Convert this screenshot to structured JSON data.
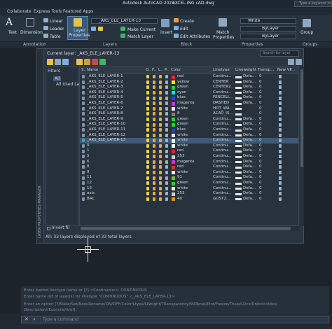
{
  "window": {
    "app_title": "Autodesk AutoCAD 2023",
    "doc_title": "eXCEL-iNG cAD.dwg",
    "search_placeholder": "Type a keyword or phrase"
  },
  "ribbon_tabs": [
    "Collaborate",
    "Express Tools",
    "Featured Apps"
  ],
  "ribbon": {
    "text_label": "Text",
    "dimension_label": "Dimension",
    "linear_label": "Linear",
    "leader_label": "Leader",
    "table_label": "Table",
    "layer_properties_label_1": "Layer",
    "layer_properties_label_2": "Properties",
    "current_layer_combo": "_AKS_ELE_LAYER-13",
    "make_current_label": "Make Current",
    "match_layer_label": "Match Layer",
    "insert_label": "Insert",
    "create_label": "Create",
    "edit_label": "Edit",
    "edit_attributes_label": "Edit Attributes",
    "match_properties_label_1": "Match",
    "match_properties_label_2": "Properties",
    "color_combo": "White",
    "linetype_combo": "ByLayer",
    "lineweight_combo": "ByLayer",
    "group_label": "Group",
    "colors": {
      "accent": "#1e8fe0",
      "ribbon_bg": "#27333f"
    }
  },
  "panel_titles": [
    "Annotation",
    "Layers",
    "Block",
    "Properties",
    "Groups"
  ],
  "layer_manager": {
    "side_title": "LAYER PROPERTIES MANAGER",
    "current_layer_text": "Current layer: _AKS_ELE_LAYER-13",
    "search_placeholder": "Search for layer",
    "filters_header": "Filters",
    "filter_items": [
      "All",
      "All Used Layers"
    ],
    "invert_filter": "Invert fil",
    "status_text": "All: 33 layers displayed of 33 total layers",
    "columns": [
      "S..",
      "Name",
      "O..",
      "F..",
      "L..",
      "P..",
      "Color",
      "Linetype",
      "Lineweight",
      "Transp...",
      "New VP..."
    ],
    "rows": [
      {
        "name": "_AKS_ELE_LAYER-1",
        "color_name": "red",
        "color_hex": "#e12b2b",
        "linetype": "Continu...",
        "lw": "Defa...",
        "tr": "0"
      },
      {
        "name": "_AKS_ELE_LAYER-2",
        "color_name": "yellow",
        "color_hex": "#ffff00",
        "linetype": "CENTER",
        "lw": "Defa...",
        "tr": "0"
      },
      {
        "name": "_AKS_ELE_LAYER-3",
        "color_name": "green",
        "color_hex": "#2bd42b",
        "linetype": "CENTER2",
        "lw": "Defa...",
        "tr": "0"
      },
      {
        "name": "_AKS_ELE_LAYER-4",
        "color_name": "cyan",
        "color_hex": "#00e5e5",
        "linetype": "Continu...",
        "lw": "Defa...",
        "tr": "0"
      },
      {
        "name": "_AKS_ELE_LAYER-5",
        "color_name": "blue",
        "color_hex": "#2b3bff",
        "linetype": "FENCELI...",
        "lw": "Defa...",
        "tr": "0"
      },
      {
        "name": "_AKS_ELE_LAYER-6",
        "color_name": "magenta",
        "color_hex": "#e02be0",
        "linetype": "DASHED",
        "lw": "Defa...",
        "tr": "0"
      },
      {
        "name": "_AKS_ELE_LAYER-7",
        "color_name": "white",
        "color_hex": "#ffffff",
        "linetype": "HOT_WA...",
        "lw": "",
        "tr": "0"
      },
      {
        "name": "_AKS_ELE_LAYER-8",
        "color_name": "8",
        "color_hex": "#808080",
        "linetype": "ACAD_IS...",
        "lw": "",
        "tr": "0"
      },
      {
        "name": "_AKS_ELE_LAYER-9",
        "color_name": "green",
        "color_hex": "#2bd42b",
        "linetype": "Continu...",
        "lw": "Defa...",
        "tr": "0"
      },
      {
        "name": "_AKS_ELE_LAYER-10",
        "color_name": "green",
        "color_hex": "#2bd42b",
        "linetype": "Continu...",
        "lw": "Defa...",
        "tr": "0"
      },
      {
        "name": "_AKS_ELE_LAYER-11",
        "color_name": "blue",
        "color_hex": "#2b3bff",
        "linetype": "Continu...",
        "lw": "Defa...",
        "tr": "0"
      },
      {
        "name": "_AKS_ELE_LAYER-12",
        "color_name": "white",
        "color_hex": "#ffffff",
        "linetype": "Continu...",
        "lw": "Defa...",
        "tr": "0"
      },
      {
        "name": "_AKS_ELE_LAYER-13",
        "color_name": "white",
        "color_hex": "#ffffff",
        "linetype": "Continu...",
        "lw": "Defa...",
        "tr": "0",
        "selected": true
      },
      {
        "name": "0",
        "color_name": "white",
        "color_hex": "#ffffff",
        "linetype": "Continu...",
        "lw": "Defa...",
        "tr": "0"
      },
      {
        "name": "1",
        "color_name": "red",
        "color_hex": "#e12b2b",
        "linetype": "Continu...",
        "lw": "Defa...",
        "tr": "0"
      },
      {
        "name": "5",
        "color_name": "253",
        "color_hex": "#d0d0d0",
        "linetype": "Continu...",
        "lw": "Defa...",
        "tr": "0"
      },
      {
        "name": "6",
        "color_name": "magenta",
        "color_hex": "#e02be0",
        "linetype": "Continu...",
        "lw": "Defa...",
        "tr": "0"
      },
      {
        "name": "8",
        "color_name": "red",
        "color_hex": "#e12b2b",
        "linetype": "Continu...",
        "lw": "Defa...",
        "tr": "0"
      },
      {
        "name": "9",
        "color_name": "white",
        "color_hex": "#ffffff",
        "linetype": "Continu...",
        "lw": "Defa...",
        "tr": "0"
      },
      {
        "name": "11",
        "color_name": "91",
        "color_hex": "#6fbf3f",
        "linetype": "Continu...",
        "lw": "Defa...",
        "tr": "0"
      },
      {
        "name": "12",
        "color_name": "green",
        "color_hex": "#2bd42b",
        "linetype": "Continu...",
        "lw": "Defa...",
        "tr": "0"
      },
      {
        "name": "13",
        "color_name": "white",
        "color_hex": "#ffffff",
        "linetype": "Continu...",
        "lw": "Defa...",
        "tr": "0"
      },
      {
        "name": "axis",
        "color_name": "253",
        "color_hex": "#d0d0d0",
        "linetype": "Continu...",
        "lw": "Defa...",
        "tr": "0"
      },
      {
        "name": "BAC",
        "color_name": "40",
        "color_hex": "#ff8c00",
        "linetype": "GOST2...",
        "lw": "Defa...",
        "tr": "0"
      }
    ]
  },
  "command": {
    "history": [
      "Enter loaded linetype name or [?] <Continuous>: CONTINUOUS",
      "Enter name list of layer(s) for linetype \"CONTINUOUS\" <_AKS_ELE_LAYER-13>:",
      "Enter an option [?/Make/Set/New/Rename/ON/OFF/Color/Ltype/LWeight/TRansparency/MATerial/Plot/Freeze/Thaw/LOck/Unlock/stAte/",
      "Description/rEconcile/Xref]:"
    ],
    "placeholder": "Type a command"
  }
}
